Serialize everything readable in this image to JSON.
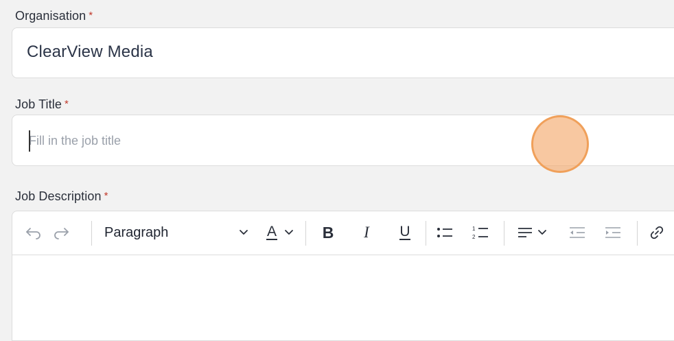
{
  "organisation": {
    "label": "Organisation",
    "required_marker": "*",
    "value": "ClearView Media"
  },
  "job_title": {
    "label": "Job Title",
    "required_marker": "*",
    "value": "",
    "placeholder": "Fill in the job title"
  },
  "job_description": {
    "label": "Job Description",
    "required_marker": "*",
    "toolbar": {
      "undo_icon": "undo-icon",
      "redo_icon": "redo-icon",
      "block_format": "Paragraph",
      "text_color_glyph": "A",
      "bold_glyph": "B",
      "italic_glyph": "I",
      "underline_glyph": "U",
      "bulleted_list_icon": "bulleted-list-icon",
      "numbered_list_icon": "numbered-list-icon",
      "align_icon": "align-left-icon",
      "outdent_icon": "outdent-icon",
      "indent_icon": "indent-icon",
      "link_icon": "link-icon"
    },
    "content": ""
  },
  "colors": {
    "required": "#c0392b",
    "text": "#2b3447",
    "placeholder": "#9aa0aa",
    "cursor_highlight": "#f0a05a"
  }
}
